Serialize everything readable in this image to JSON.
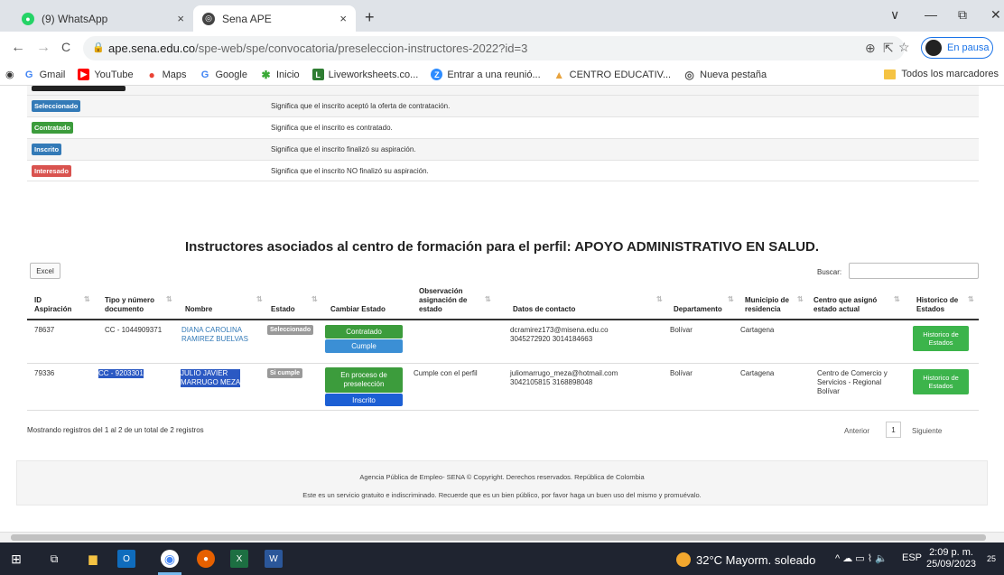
{
  "browser": {
    "tabs": [
      {
        "title": "(9) WhatsApp",
        "close": "×",
        "favicon_color": "#25d366"
      },
      {
        "title": "Sena APE",
        "close": "×",
        "favicon_color": "#444"
      }
    ],
    "new_tab": "+",
    "window_controls": {
      "minimize": "—",
      "restore": "⧉",
      "close": "✕",
      "tab_menu": "∨"
    },
    "nav": {
      "back": "←",
      "forward": "→",
      "reload": "C"
    },
    "url_host": "ape.sena.edu.co",
    "url_path": "/spe-web/spe/convocatoria/preseleccion-instructores-2022?id=3",
    "profile_label": "En pausa",
    "bookmarks": [
      {
        "label": "Gmail",
        "icon": "G",
        "color": "#4285f4"
      },
      {
        "label": "YouTube",
        "icon": "▶",
        "color": "#ff0000"
      },
      {
        "label": "Maps",
        "icon": "●",
        "color": "#34a853"
      },
      {
        "label": "Google",
        "icon": "G",
        "color": "#4285f4"
      },
      {
        "label": "Inicio",
        "icon": "✱",
        "color": "#39a935"
      },
      {
        "label": "Liveworksheets.co...",
        "icon": "L",
        "color": "#2e7d32"
      },
      {
        "label": "Entrar a una reunió...",
        "icon": "Z",
        "color": "#2d8cff"
      },
      {
        "label": "CENTRO EDUCATIV...",
        "icon": "▲",
        "color": "#e8a33d"
      },
      {
        "label": "Nueva pestaña",
        "icon": "◎",
        "color": "#555"
      }
    ],
    "all_bookmarks": "Todos los marcadores"
  },
  "legend": [
    {
      "label": "Seleccionado",
      "color": "#337ab7",
      "desc": "Significa que el inscrito aceptó la oferta de contratación."
    },
    {
      "label": "Contratado",
      "color": "#3c9c3c",
      "desc": "Significa que el inscrito es contratado."
    },
    {
      "label": "Inscrito",
      "color": "#337ab7",
      "desc": "Significa que el inscrito finalizó su aspiración."
    },
    {
      "label": "Interesado",
      "color": "#d9534f",
      "desc": "Significa que el inscrito NO finalizó su aspiración."
    }
  ],
  "section_title": "Instructores asociados al centro de formación para el perfil: APOYO ADMINISTRATIVO EN SALUD.",
  "excel_label": "Excel",
  "search_label": "Buscar:",
  "table": {
    "headers": {
      "id": "ID\nAspiración",
      "doc": "Tipo y número\ndocumento",
      "name": "Nombre",
      "estado": "Estado",
      "cambiar": "Cambiar Estado",
      "obs": "Observación\nasignación de\nestado",
      "contacto": "Datos de contacto",
      "depto": "Departamento",
      "municipio": "Municipio de\nresidencia",
      "centro": "Centro que asignó\nestado actual",
      "historico": "Historico de\nEstados"
    },
    "rows": [
      {
        "id": "78637",
        "doc": "CC - 1044909371",
        "name": "DIANA CAROLINA\nRAMIREZ BUELVAS",
        "estado": "Seleccionado",
        "btn1": "Contratado",
        "btn2": "Cumple",
        "obs": "",
        "contacto": "dcramirez173@misena.edu.co\n3045272920 3014184663",
        "depto": "Bolívar",
        "municipio": "Cartagena",
        "centro": "",
        "historico": "Historico de\nEstados"
      },
      {
        "id": "79336",
        "doc": "CC - 9203301",
        "name": "JULIO JAVIER\nMARRUGO MEZA",
        "estado": "Si cumple",
        "btn1": "En proceso de\npreselección",
        "btn2": "Inscrito",
        "obs": "Cumple con el perfil",
        "contacto": "juliomarrugo_meza@hotmail.com\n3042105815 3168898048",
        "depto": "Bolívar",
        "municipio": "Cartagena",
        "centro": "Centro de Comercio y\nServicios - Regional\nBolívar",
        "historico": "Historico de\nEstados"
      }
    ]
  },
  "info_text": "Mostrando registros del 1 al 2 de un total de 2 registros",
  "pager": {
    "prev": "Anterior",
    "page": "1",
    "next": "Siguiente"
  },
  "footer": {
    "line1": "Agencia Pública de Empleo- SENA © Copyright. Derechos reservados. República de Colombia",
    "line2": "Este es un servicio gratuito e indiscriminado. Recuerde que es un bien público, por favor haga un buen uso del mismo y promuévalo."
  },
  "taskbar": {
    "weather": "32°C  Mayorm. soleado",
    "lang": "ESP",
    "time": "2:09 p. m.",
    "date": "25/09/2023",
    "notif": "25"
  }
}
